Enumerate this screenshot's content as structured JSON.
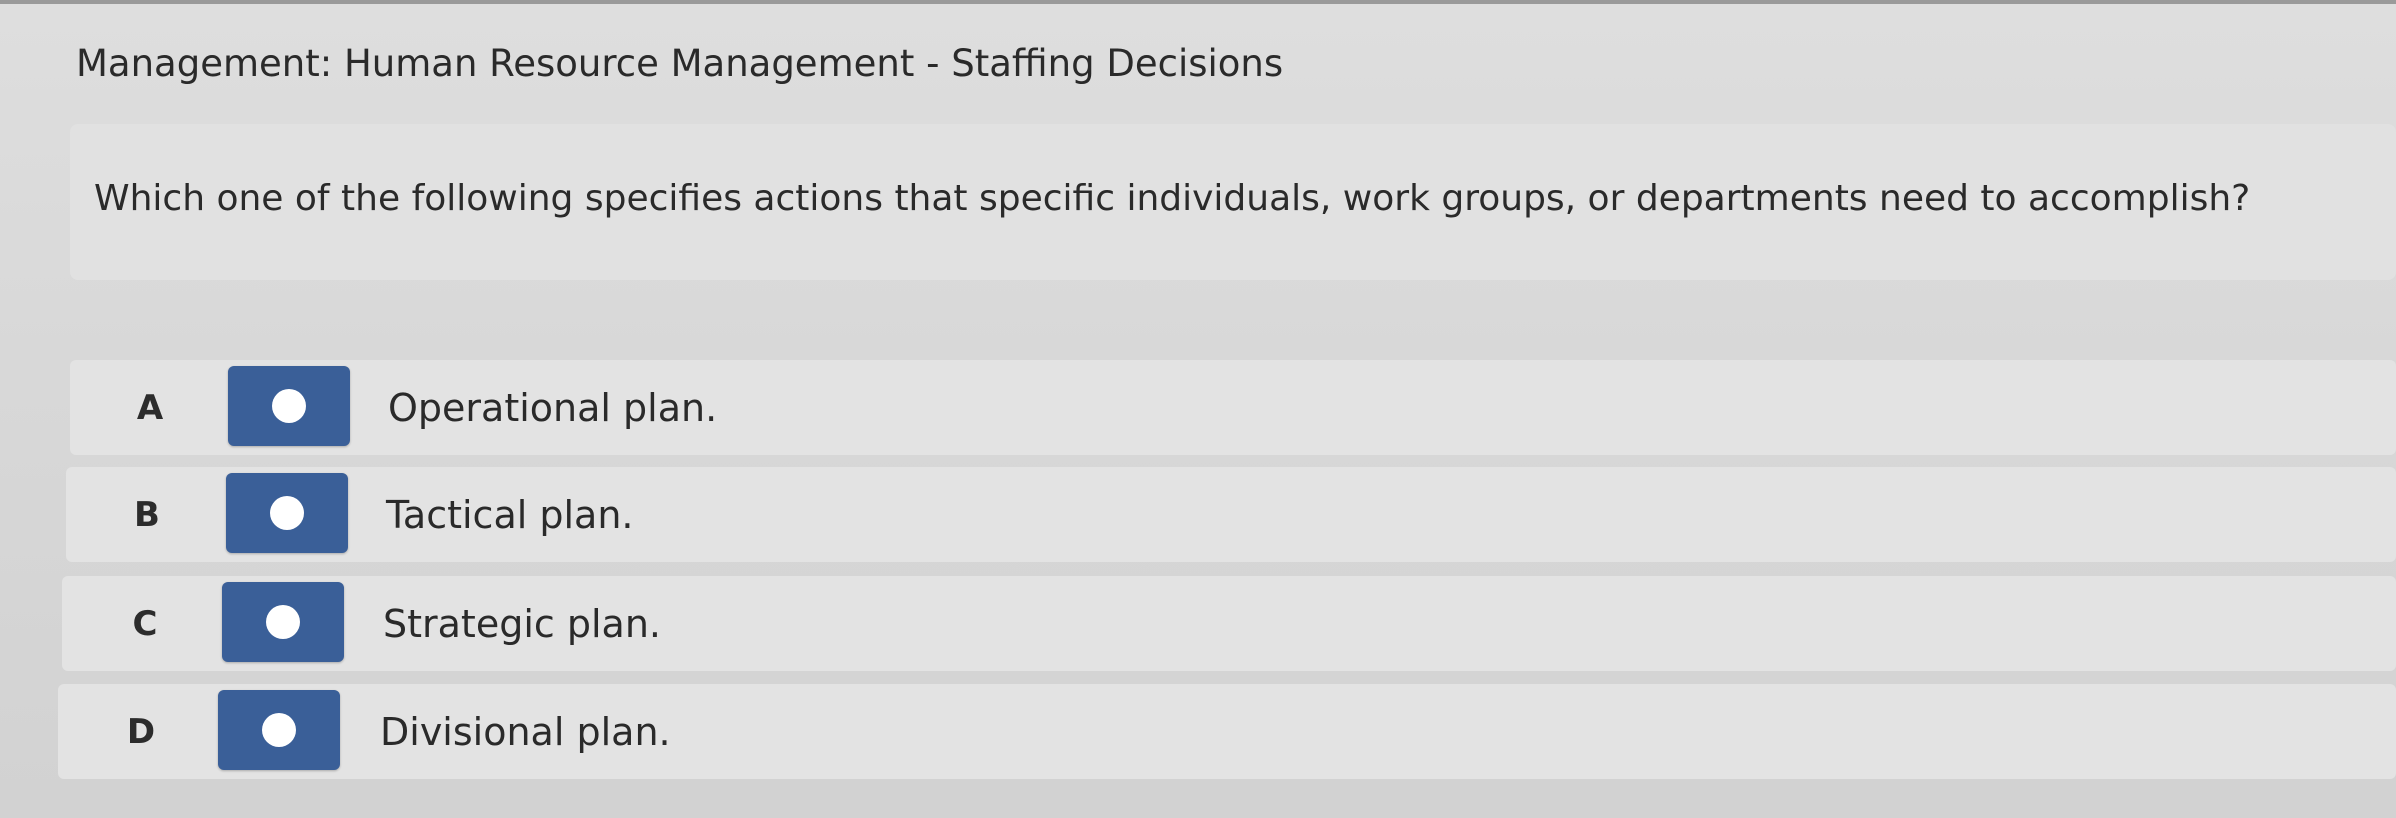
{
  "header": {
    "title": "Management: Human Resource Management - Staffing Decisions"
  },
  "question": {
    "text": "Which one of the following specifies actions that specific individuals, work groups, or departments need to accomplish?"
  },
  "options": [
    {
      "letter": "A",
      "label": "Operational plan."
    },
    {
      "letter": "B",
      "label": "Tactical plan."
    },
    {
      "letter": "C",
      "label": "Strategic plan."
    },
    {
      "letter": "D",
      "label": "Divisional plan."
    }
  ],
  "colors": {
    "radio_button": "#3a5f98",
    "radio_dot": "#ffffff"
  }
}
